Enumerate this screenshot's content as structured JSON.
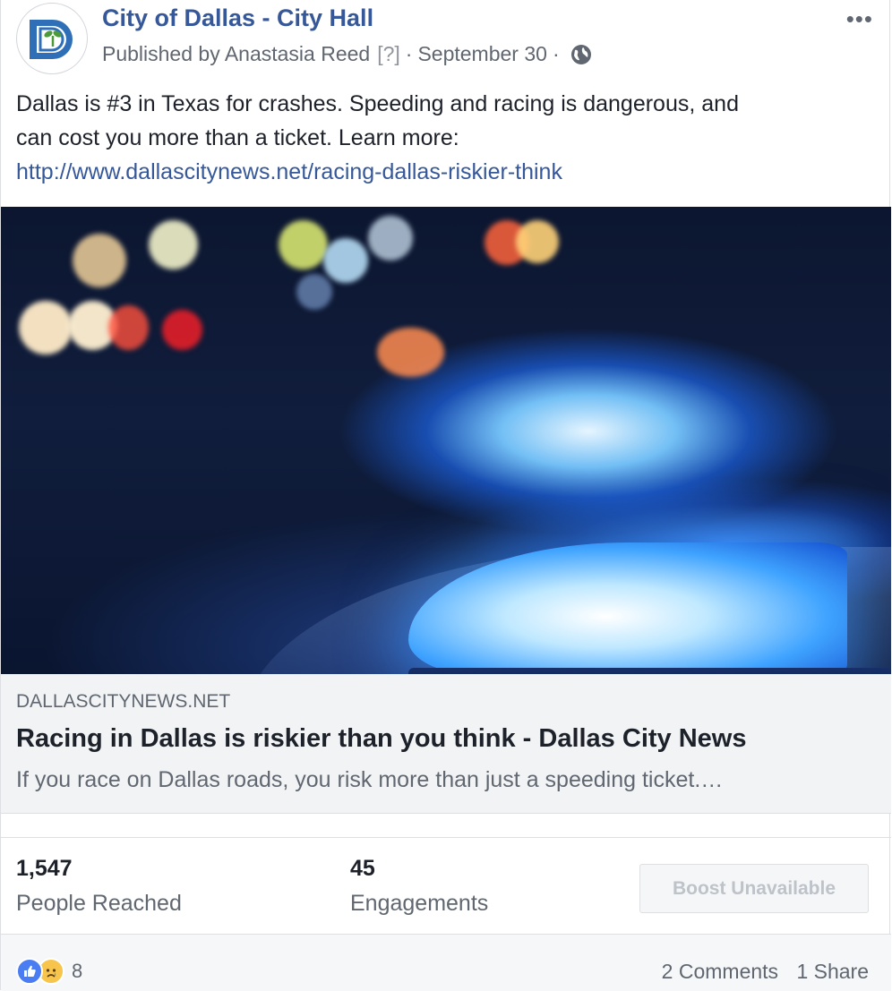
{
  "post": {
    "page_name": "City of Dallas - City Hall",
    "published_by": "Published by Anastasia Reed",
    "help_marker": "[?]",
    "separator": "·",
    "date": "September 30",
    "more_icon": "•••",
    "text_line1": "Dallas is #3 in Texas for crashes. Speeding and racing is dangerous, and",
    "text_line2": "can cost you more than a ticket. Learn more:",
    "link_url": "http://www.dallascitynews.net/racing-dallas-riskier-think"
  },
  "link_preview": {
    "domain": "DALLASCITYNEWS.NET",
    "title": "Racing in Dallas is riskier than you think - Dallas City News",
    "description": "If you race on Dallas roads, you risk more than just a speeding ticket.…"
  },
  "stats": {
    "reached_value": "1,547",
    "reached_label": "People Reached",
    "engagements_value": "45",
    "engagements_label": "Engagements",
    "boost_label": "Boost Unavailable"
  },
  "footer": {
    "reaction_count": "8",
    "comments": "2 Comments",
    "shares": "1 Share"
  },
  "colors": {
    "link_blue": "#365899",
    "like_blue": "#4a7cf2",
    "sad_yellow": "#f7c44c"
  }
}
